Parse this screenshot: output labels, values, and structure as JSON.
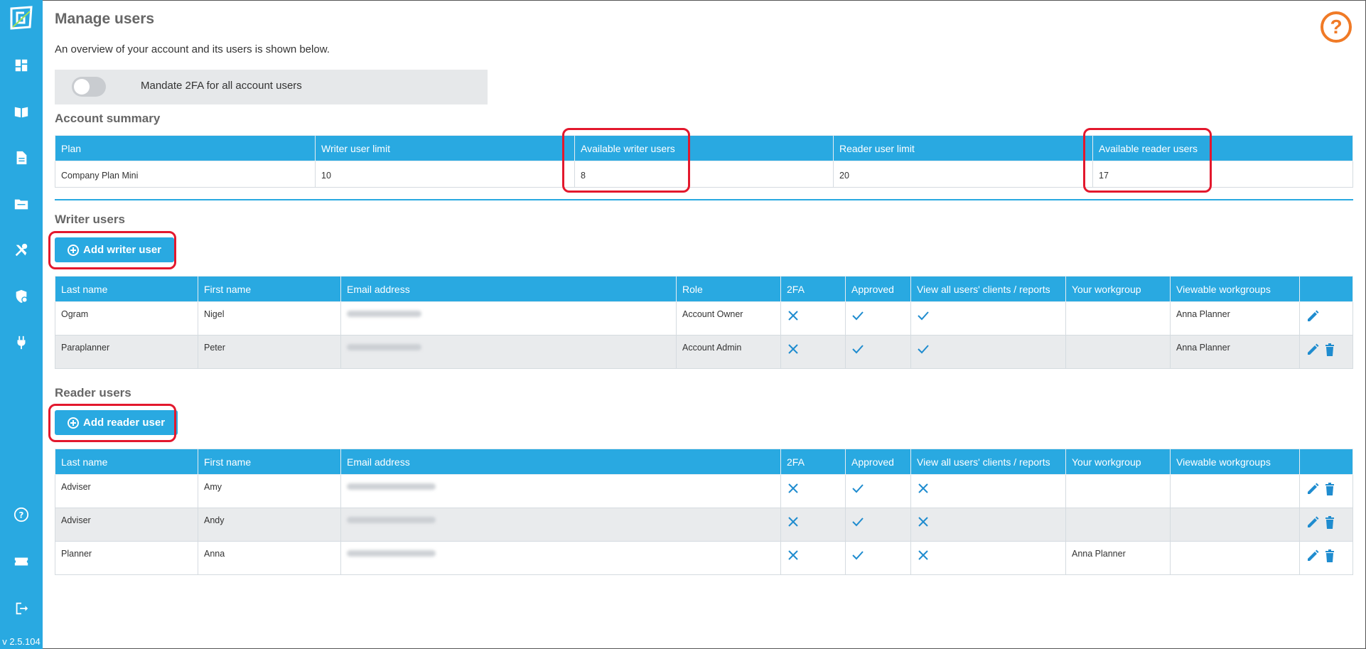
{
  "app": {
    "version": "v 2.5.104",
    "colors": {
      "accent": "#29a9e1",
      "help": "#f07a26",
      "highlight": "#e3182d"
    }
  },
  "sidebar": {
    "items": [
      {
        "icon": "dashboard-icon"
      },
      {
        "icon": "book-icon"
      },
      {
        "icon": "document-icon"
      },
      {
        "icon": "folder-icon"
      },
      {
        "icon": "tools-icon"
      },
      {
        "icon": "security-shield-icon"
      },
      {
        "icon": "plug-icon"
      }
    ],
    "bottom": [
      {
        "icon": "help-icon"
      },
      {
        "icon": "ticket-icon"
      },
      {
        "icon": "logout-icon"
      }
    ]
  },
  "page": {
    "title": "Manage users",
    "intro": "An overview of your account and its users is shown below.",
    "mandate_2fa_label": "Mandate 2FA for all account users",
    "mandate_2fa_on": false
  },
  "account_summary": {
    "title": "Account summary",
    "headers": [
      "Plan",
      "Writer user limit",
      "Available writer users",
      "Reader user limit",
      "Available reader users"
    ],
    "row": [
      "Company Plan Mini",
      "10",
      "8",
      "20",
      "17"
    ]
  },
  "writer_users": {
    "title": "Writer users",
    "add_label": "Add writer user",
    "headers": [
      "Last name",
      "First name",
      "Email address",
      "Role",
      "2FA",
      "Approved",
      "View all users' clients / reports",
      "Your workgroup",
      "Viewable workgroups",
      ""
    ],
    "rows": [
      {
        "last": "Ogram",
        "first": "Nigel",
        "role": "Account Owner",
        "twofa": false,
        "approved": true,
        "view_all": true,
        "workgroup": "",
        "viewable": "Anna Planner",
        "can_delete": false
      },
      {
        "last": "Paraplanner",
        "first": "Peter",
        "role": "Account Admin",
        "twofa": false,
        "approved": true,
        "view_all": true,
        "workgroup": "",
        "viewable": "Anna Planner",
        "can_delete": true
      }
    ]
  },
  "reader_users": {
    "title": "Reader users",
    "add_label": "Add reader user",
    "headers": [
      "Last name",
      "First name",
      "Email address",
      "2FA",
      "Approved",
      "View all users' clients / reports",
      "Your workgroup",
      "Viewable workgroups",
      ""
    ],
    "rows": [
      {
        "last": "Adviser",
        "first": "Amy",
        "twofa": false,
        "approved": true,
        "view_all": false,
        "workgroup": "",
        "viewable": ""
      },
      {
        "last": "Adviser",
        "first": "Andy",
        "twofa": false,
        "approved": true,
        "view_all": false,
        "workgroup": "",
        "viewable": ""
      },
      {
        "last": "Planner",
        "first": "Anna",
        "twofa": false,
        "approved": true,
        "view_all": false,
        "workgroup": "Anna Planner",
        "viewable": ""
      }
    ]
  }
}
